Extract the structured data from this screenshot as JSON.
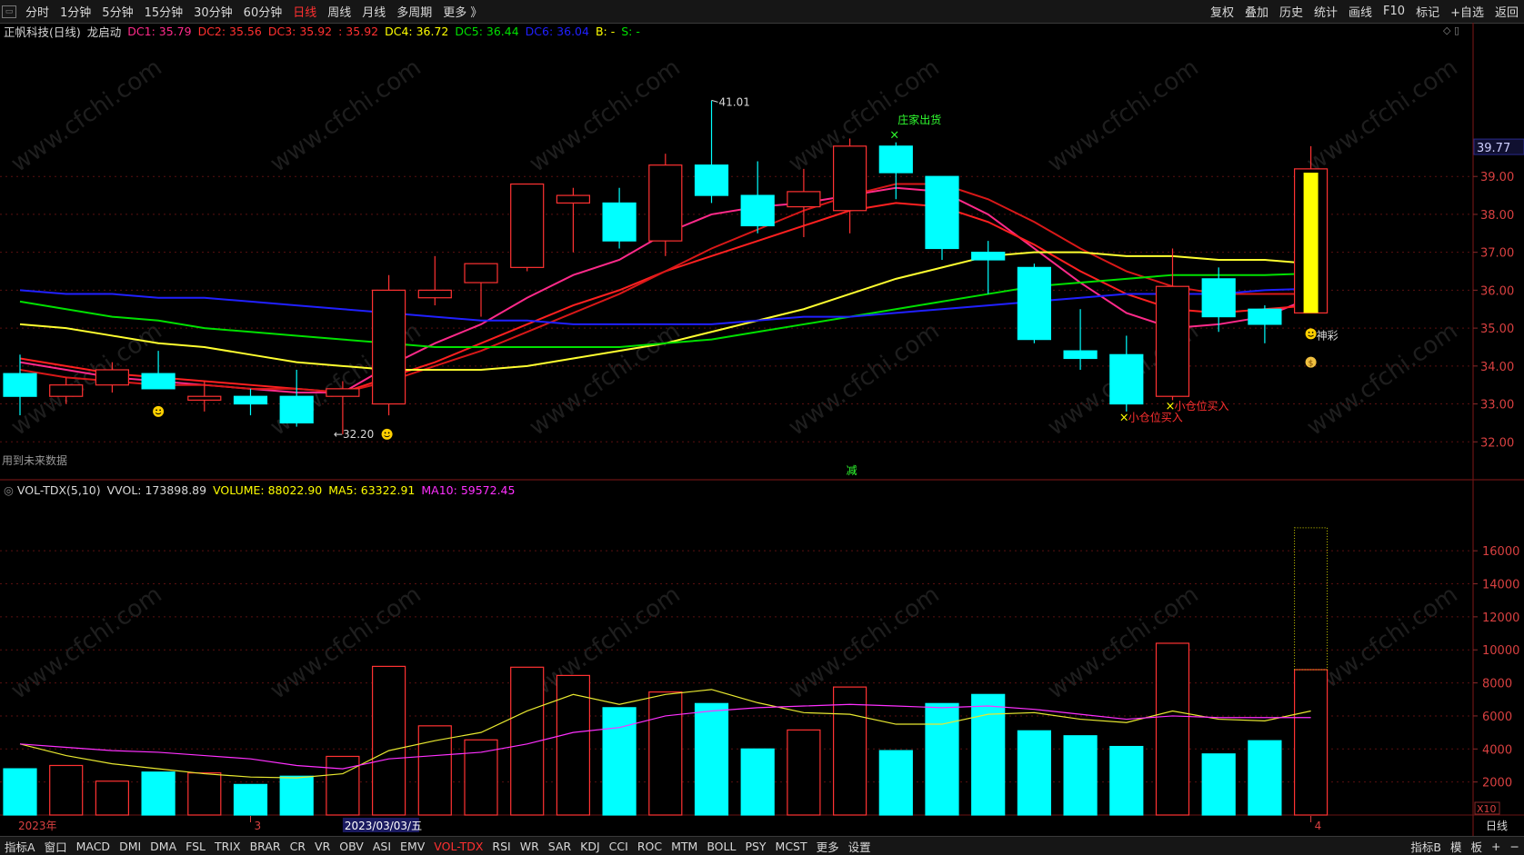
{
  "toolbar": {
    "window_icon": "window-icon",
    "periods": [
      "分时",
      "1分钟",
      "5分钟",
      "15分钟",
      "30分钟",
      "60分钟",
      "日线",
      "周线",
      "月线",
      "多周期",
      "更多 》"
    ],
    "active_period": "日线",
    "right_items": [
      "复权",
      "叠加",
      "历史",
      "统计",
      "画线",
      "F10",
      "标记",
      "+自选",
      "返回"
    ]
  },
  "main_legend": {
    "stock": "正帆科技(日线)",
    "indicator": "龙启动",
    "items": [
      {
        "text": "DC1: 35.79",
        "color": "#ff2a8a"
      },
      {
        "text": "DC2: 35.56",
        "color": "#ff3030"
      },
      {
        "text": "DC3: 35.92",
        "color": "#ff3030"
      },
      {
        "text": ": 35.92",
        "color": "#ff3030"
      },
      {
        "text": "DC4: 36.72",
        "color": "#ffff00"
      },
      {
        "text": "DC5: 36.44",
        "color": "#00e000"
      },
      {
        "text": "DC6: 36.04",
        "color": "#2020ff"
      },
      {
        "text": "B: -",
        "color": "#ffff00"
      },
      {
        "text": "S: -",
        "color": "#00e000"
      }
    ]
  },
  "volume_legend": {
    "title": "VOL-TDX(5,10)",
    "items": [
      {
        "text": "VVOL: 173898.89",
        "color": "#d8d8d8"
      },
      {
        "text": "VOLUME: 88022.90",
        "color": "#ffff00"
      },
      {
        "text": "MA5: 63322.91",
        "color": "#ffff00"
      },
      {
        "text": "MA10: 59572.45",
        "color": "#ff30ff"
      }
    ]
  },
  "annotations": {
    "high_label": "41.01",
    "low_label": "←32.20",
    "dealer_sell": "庄家出货",
    "buy_small_1": "小仓位买入",
    "buy_small_2": "小仓位买入",
    "shen_cai": "神彩",
    "future_data": "用到未来数据",
    "reduce": "减",
    "last_price": "39.77",
    "x10": "X10"
  },
  "date_axis": {
    "year": "2023年",
    "month3": "3",
    "cursor_date": "2023/03/03/五",
    "month4": "4",
    "period_label": "日线"
  },
  "bottom_tabs": {
    "items": [
      "指标A",
      "窗口",
      "MACD",
      "DMI",
      "DMA",
      "FSL",
      "TRIX",
      "BRAR",
      "CR",
      "VR",
      "OBV",
      "ASI",
      "EMV",
      "VOL-TDX",
      "RSI",
      "WR",
      "SAR",
      "KDJ",
      "CCI",
      "ROC",
      "MTM",
      "BOLL",
      "PSY",
      "MCST",
      "更多",
      "设置"
    ],
    "active": "VOL-TDX",
    "right_items": [
      "指标B",
      "模",
      "板",
      "+",
      "−"
    ]
  },
  "colors": {
    "up": "#ff3232",
    "down": "#00ffff",
    "signal_bar": "#ffff00",
    "dc1": "#ff2a8a",
    "dc2": "#ff2020",
    "dc3": "#d81818",
    "dc4": "#ffff30",
    "dc5": "#00e000",
    "dc6": "#2020ff",
    "ma5": "#e8e830",
    "ma10": "#ff30ff"
  },
  "chart_data": {
    "type": "candlestick",
    "price_axis": {
      "ticks": [
        32,
        33,
        34,
        35,
        36,
        37,
        38,
        39
      ],
      "ylim": [
        31.0,
        42.6
      ]
    },
    "volume_axis": {
      "ticks": [
        2000,
        4000,
        6000,
        8000,
        10000,
        12000,
        14000,
        16000
      ],
      "ylim": [
        0,
        19200
      ],
      "unit_label": "X10"
    },
    "candles": [
      {
        "o": 33.8,
        "h": 34.3,
        "l": 32.7,
        "c": 33.2
      },
      {
        "o": 33.2,
        "h": 33.7,
        "l": 33.0,
        "c": 33.5
      },
      {
        "o": 33.5,
        "h": 34.1,
        "l": 33.3,
        "c": 33.9
      },
      {
        "o": 33.8,
        "h": 34.4,
        "l": 33.4,
        "c": 33.4
      },
      {
        "o": 33.1,
        "h": 33.6,
        "l": 32.8,
        "c": 33.2
      },
      {
        "o": 33.2,
        "h": 33.4,
        "l": 32.7,
        "c": 33.0
      },
      {
        "o": 33.2,
        "h": 33.9,
        "l": 32.4,
        "c": 32.5
      },
      {
        "o": 33.2,
        "h": 33.6,
        "l": 32.2,
        "c": 33.4
      },
      {
        "o": 33.0,
        "h": 36.4,
        "l": 32.7,
        "c": 36.0
      },
      {
        "o": 35.8,
        "h": 36.9,
        "l": 35.6,
        "c": 36.0
      },
      {
        "o": 36.2,
        "h": 36.6,
        "l": 35.3,
        "c": 36.7
      },
      {
        "o": 36.6,
        "h": 38.6,
        "l": 36.5,
        "c": 38.8
      },
      {
        "o": 38.3,
        "h": 38.7,
        "l": 37.0,
        "c": 38.5
      },
      {
        "o": 38.3,
        "h": 38.7,
        "l": 37.1,
        "c": 37.3
      },
      {
        "o": 37.3,
        "h": 39.6,
        "l": 36.9,
        "c": 39.3
      },
      {
        "o": 39.3,
        "h": 41.0,
        "l": 38.3,
        "c": 38.5
      },
      {
        "o": 38.5,
        "h": 39.4,
        "l": 37.5,
        "c": 37.7
      },
      {
        "o": 38.2,
        "h": 39.2,
        "l": 37.4,
        "c": 38.6
      },
      {
        "o": 38.1,
        "h": 40.0,
        "l": 37.5,
        "c": 39.8
      },
      {
        "o": 39.8,
        "h": 39.9,
        "l": 38.4,
        "c": 39.1
      },
      {
        "o": 39.0,
        "h": 39.0,
        "l": 36.8,
        "c": 37.1
      },
      {
        "o": 37.0,
        "h": 37.3,
        "l": 35.9,
        "c": 36.8
      },
      {
        "o": 36.6,
        "h": 36.7,
        "l": 34.6,
        "c": 34.7
      },
      {
        "o": 34.4,
        "h": 35.5,
        "l": 33.9,
        "c": 34.2
      },
      {
        "o": 34.3,
        "h": 34.8,
        "l": 32.8,
        "c": 33.0
      },
      {
        "o": 33.2,
        "h": 37.1,
        "l": 33.1,
        "c": 36.1
      },
      {
        "o": 36.3,
        "h": 36.6,
        "l": 34.9,
        "c": 35.3
      },
      {
        "o": 35.5,
        "h": 35.6,
        "l": 34.6,
        "c": 35.1
      },
      {
        "o": 35.4,
        "h": 39.8,
        "l": 35.4,
        "c": 39.2
      }
    ],
    "signal_bar": {
      "index": 28,
      "from": 35.4,
      "to": 39.1
    },
    "volume": [
      2800,
      3000,
      2050,
      2600,
      2550,
      1850,
      2350,
      3550,
      9000,
      5400,
      4550,
      8950,
      8450,
      6500,
      7450,
      6750,
      4000,
      5150,
      7750,
      3900,
      6750,
      7300,
      5100,
      4800,
      4150,
      10400,
      3700,
      4500,
      8800
    ],
    "vvol_last": 17390,
    "series": [
      {
        "name": "DC1",
        "values": [
          34.1,
          33.9,
          33.7,
          33.6,
          33.5,
          33.4,
          33.3,
          33.3,
          34.0,
          34.6,
          35.1,
          35.8,
          36.4,
          36.8,
          37.5,
          38.0,
          38.2,
          38.3,
          38.5,
          38.7,
          38.6,
          38.0,
          37.1,
          36.2,
          35.4,
          35.0,
          35.1,
          35.3,
          35.8
        ]
      },
      {
        "name": "DC2",
        "values": [
          34.2,
          34.0,
          33.8,
          33.7,
          33.6,
          33.5,
          33.4,
          33.3,
          33.7,
          34.1,
          34.6,
          35.1,
          35.6,
          36.0,
          36.5,
          36.9,
          37.3,
          37.7,
          38.1,
          38.3,
          38.2,
          37.8,
          37.2,
          36.5,
          35.9,
          35.5,
          35.4,
          35.5,
          35.6
        ]
      },
      {
        "name": "DC3",
        "values": [
          33.9,
          33.7,
          33.6,
          33.5,
          33.5,
          33.4,
          33.4,
          33.3,
          33.6,
          34.0,
          34.4,
          34.9,
          35.4,
          35.9,
          36.5,
          37.1,
          37.6,
          38.1,
          38.5,
          38.8,
          38.8,
          38.4,
          37.8,
          37.1,
          36.5,
          36.1,
          35.9,
          35.9,
          35.9
        ]
      },
      {
        "name": "DC4",
        "values": [
          35.1,
          35.0,
          34.8,
          34.6,
          34.5,
          34.3,
          34.1,
          34.0,
          33.9,
          33.9,
          33.9,
          34.0,
          34.2,
          34.4,
          34.6,
          34.9,
          35.2,
          35.5,
          35.9,
          36.3,
          36.6,
          36.9,
          37.0,
          37.0,
          36.9,
          36.9,
          36.8,
          36.8,
          36.7
        ]
      },
      {
        "name": "DC5",
        "values": [
          35.7,
          35.5,
          35.3,
          35.2,
          35.0,
          34.9,
          34.8,
          34.7,
          34.6,
          34.5,
          34.5,
          34.5,
          34.5,
          34.5,
          34.6,
          34.7,
          34.9,
          35.1,
          35.3,
          35.5,
          35.7,
          35.9,
          36.1,
          36.2,
          36.3,
          36.4,
          36.4,
          36.4,
          36.44
        ]
      },
      {
        "name": "DC6",
        "values": [
          36.0,
          35.9,
          35.9,
          35.8,
          35.8,
          35.7,
          35.6,
          35.5,
          35.4,
          35.3,
          35.2,
          35.2,
          35.1,
          35.1,
          35.1,
          35.1,
          35.2,
          35.3,
          35.3,
          35.4,
          35.5,
          35.6,
          35.7,
          35.8,
          35.9,
          35.9,
          35.9,
          36.0,
          36.04
        ]
      },
      {
        "name": "MA5",
        "values": [
          4300,
          3600,
          3100,
          2800,
          2500,
          2300,
          2250,
          2500,
          3900,
          4500,
          5000,
          6300,
          7300,
          6700,
          7300,
          7600,
          6800,
          6200,
          6100,
          5500,
          5500,
          6100,
          6200,
          5800,
          5600,
          6300,
          5800,
          5700,
          6300
        ]
      },
      {
        "name": "MA10",
        "values": [
          4300,
          4100,
          3900,
          3800,
          3600,
          3400,
          3000,
          2800,
          3400,
          3600,
          3800,
          4300,
          5000,
          5300,
          6000,
          6300,
          6500,
          6600,
          6700,
          6600,
          6500,
          6600,
          6400,
          6100,
          5800,
          6000,
          5900,
          5900,
          5900
        ]
      }
    ]
  }
}
